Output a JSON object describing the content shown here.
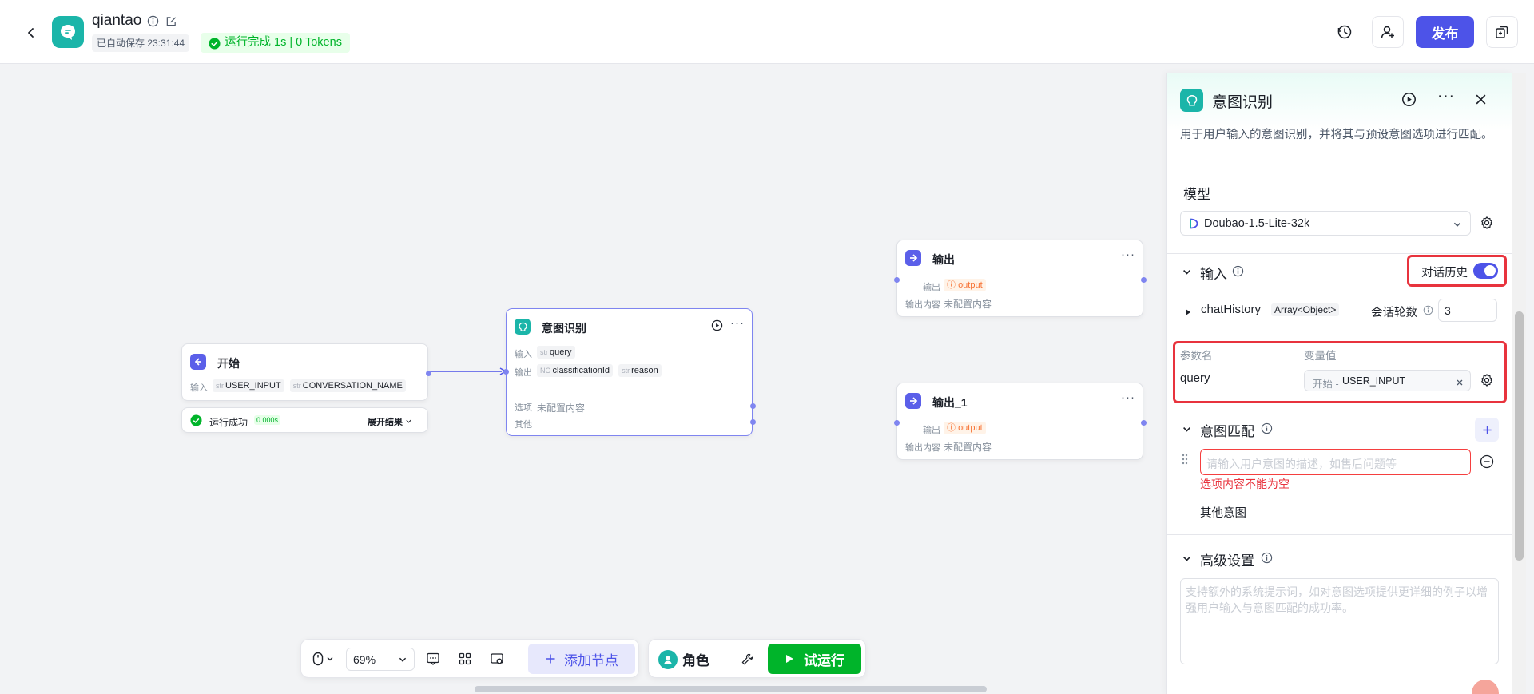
{
  "header": {
    "app_name": "qiantao",
    "autosave": "已自动保存 23:31:44",
    "run_status": "运行完成 1s | 0 Tokens",
    "publish_label": "发布"
  },
  "nodes": {
    "start": {
      "title": "开始",
      "input_label": "输入",
      "inputs": [
        {
          "type": "str",
          "name": "USER_INPUT"
        },
        {
          "type": "str",
          "name": "CONVERSATION_NAME"
        }
      ],
      "result_status": "运行成功",
      "result_time": "0.000s",
      "expand_label": "展开结果"
    },
    "intent": {
      "title": "意图识别",
      "input_label": "输入",
      "input": {
        "type": "str",
        "name": "query"
      },
      "output_label": "输出",
      "outputs": [
        {
          "type": "NO",
          "name": "classificationId"
        },
        {
          "type": "str",
          "name": "reason"
        }
      ],
      "option_label": "选项",
      "option_value": "未配置内容",
      "other_label": "其他"
    },
    "output": {
      "title": "输出",
      "output_label": "输出",
      "output_tag": "output",
      "content_label": "输出内容",
      "content_value": "未配置内容"
    },
    "output_1": {
      "title": "输出_1",
      "output_label": "输出",
      "output_tag": "output",
      "content_label": "输出内容",
      "content_value": "未配置内容"
    }
  },
  "toolbar": {
    "zoom": "69%",
    "add_node_label": "添加节点",
    "role_label": "角色",
    "test_run_label": "试运行"
  },
  "panel": {
    "title": "意图识别",
    "description": "用于用户输入的意图识别，并将其与预设意图选项进行匹配。",
    "model_section": "模型",
    "model_value": "Doubao-1.5-Lite-32k",
    "input_section": "输入",
    "chat_history_label": "对话历史",
    "chat_history_on": true,
    "chat_history_var": "chatHistory",
    "chat_history_type": "Array<Object>",
    "rounds_label": "会话轮数",
    "rounds_value": "3",
    "param_name_header": "参数名",
    "var_value_header": "变量值",
    "param_name": "query",
    "var_source": "开始 -",
    "var_name": "USER_INPUT",
    "intent_section": "意图匹配",
    "intent_placeholder": "请输入用户意图的描述，如售后问题等",
    "intent_error": "选项内容不能为空",
    "other_intent": "其他意图",
    "advanced_section": "高级设置",
    "advanced_placeholder": "支持额外的系统提示词，如对意图选项提供更详细的例子以增强用户输入与意图匹配的成功率。"
  },
  "colors": {
    "accent": "#4d53e8",
    "success": "#00b42a",
    "error": "#e8333d",
    "brand_teal": "#1bb5a9",
    "node_icon": "#5b5fe9"
  }
}
